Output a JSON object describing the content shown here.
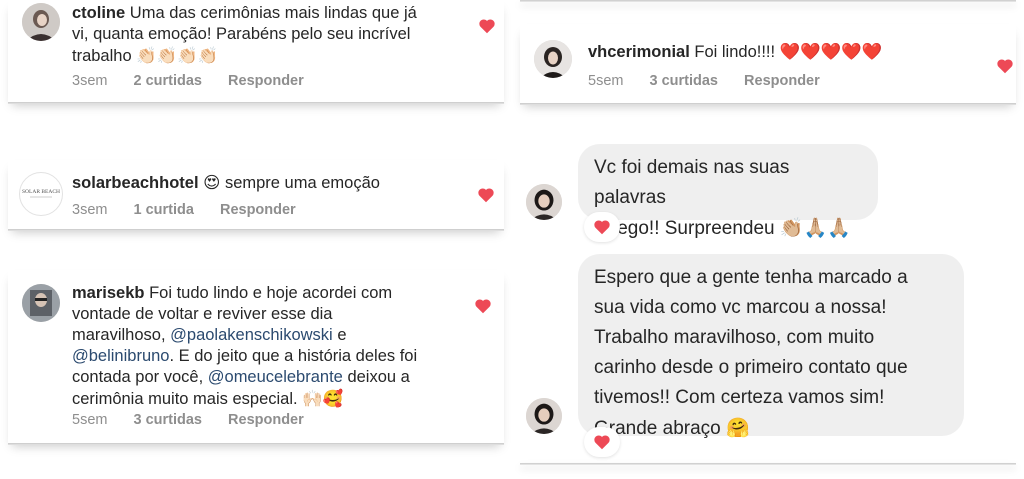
{
  "left": {
    "comments": [
      {
        "username": "ctoline",
        "text_line1": "Uma das cerimônias mais lindas que já",
        "text_line2": "vi, quanta emoção! Parabéns pelo seu incrível",
        "text_line3": "trabalho",
        "emoji": "👏🏻👏🏻👏🏻👏🏻",
        "time": "3sem",
        "likes": "2 curtidas",
        "reply": "Responder"
      },
      {
        "username": "solarbeachhotel",
        "emoji": "😍",
        "text": "sempre uma emoção",
        "avatar_text": "SOLAR BEACH",
        "time": "3sem",
        "likes": "1 curtida",
        "reply": "Responder"
      },
      {
        "username": "marisekb",
        "text_line1": "Foi tudo lindo e hoje acordei com",
        "text_line2": "vontade de voltar e reviver esse dia",
        "text_line3": "maravilhoso,",
        "mention1": "@paolakenschikowski",
        "text_and": "e",
        "mention2": "@belinibruno",
        "text_line4": ". E do jeito que a história deles foi",
        "text_line5a": "contada por você,",
        "mention3": "@omeucelebrante",
        "text_line5b": "deixou a",
        "text_line6": "cerimônia muito mais especial.",
        "emoji": "🙌🏻🥰",
        "time": "5sem",
        "likes": "3 curtidas",
        "reply": "Responder"
      }
    ]
  },
  "right": {
    "comment": {
      "username": "vhcerimonial",
      "text": "Foi lindo!!!!",
      "emoji": "❤️❤️❤️❤️❤️",
      "time": "5sem",
      "likes": "3 curtidas",
      "reply": "Responder"
    },
    "messages": [
      {
        "line1": "Vc foi demais nas suas palavras",
        "line2": "Dyego!! Surpreendeu",
        "emoji": "👏🏼🙏🏼🙏🏼"
      },
      {
        "line1": "Espero que a gente tenha marcado a",
        "line2": "sua vida como vc marcou a nossa!",
        "line3": "Trabalho maravilhoso, com muito",
        "line4": "carinho desde o primeiro contato que",
        "line5": "tivemos!! Com certeza vamos sim!",
        "line6": "Grande abraço",
        "emoji": "🤗"
      }
    ]
  },
  "colors": {
    "heart": "#ed4956",
    "text": "#262626",
    "meta": "#8e8e8e",
    "mention": "#2b4a6f",
    "bubble": "#efefef"
  }
}
